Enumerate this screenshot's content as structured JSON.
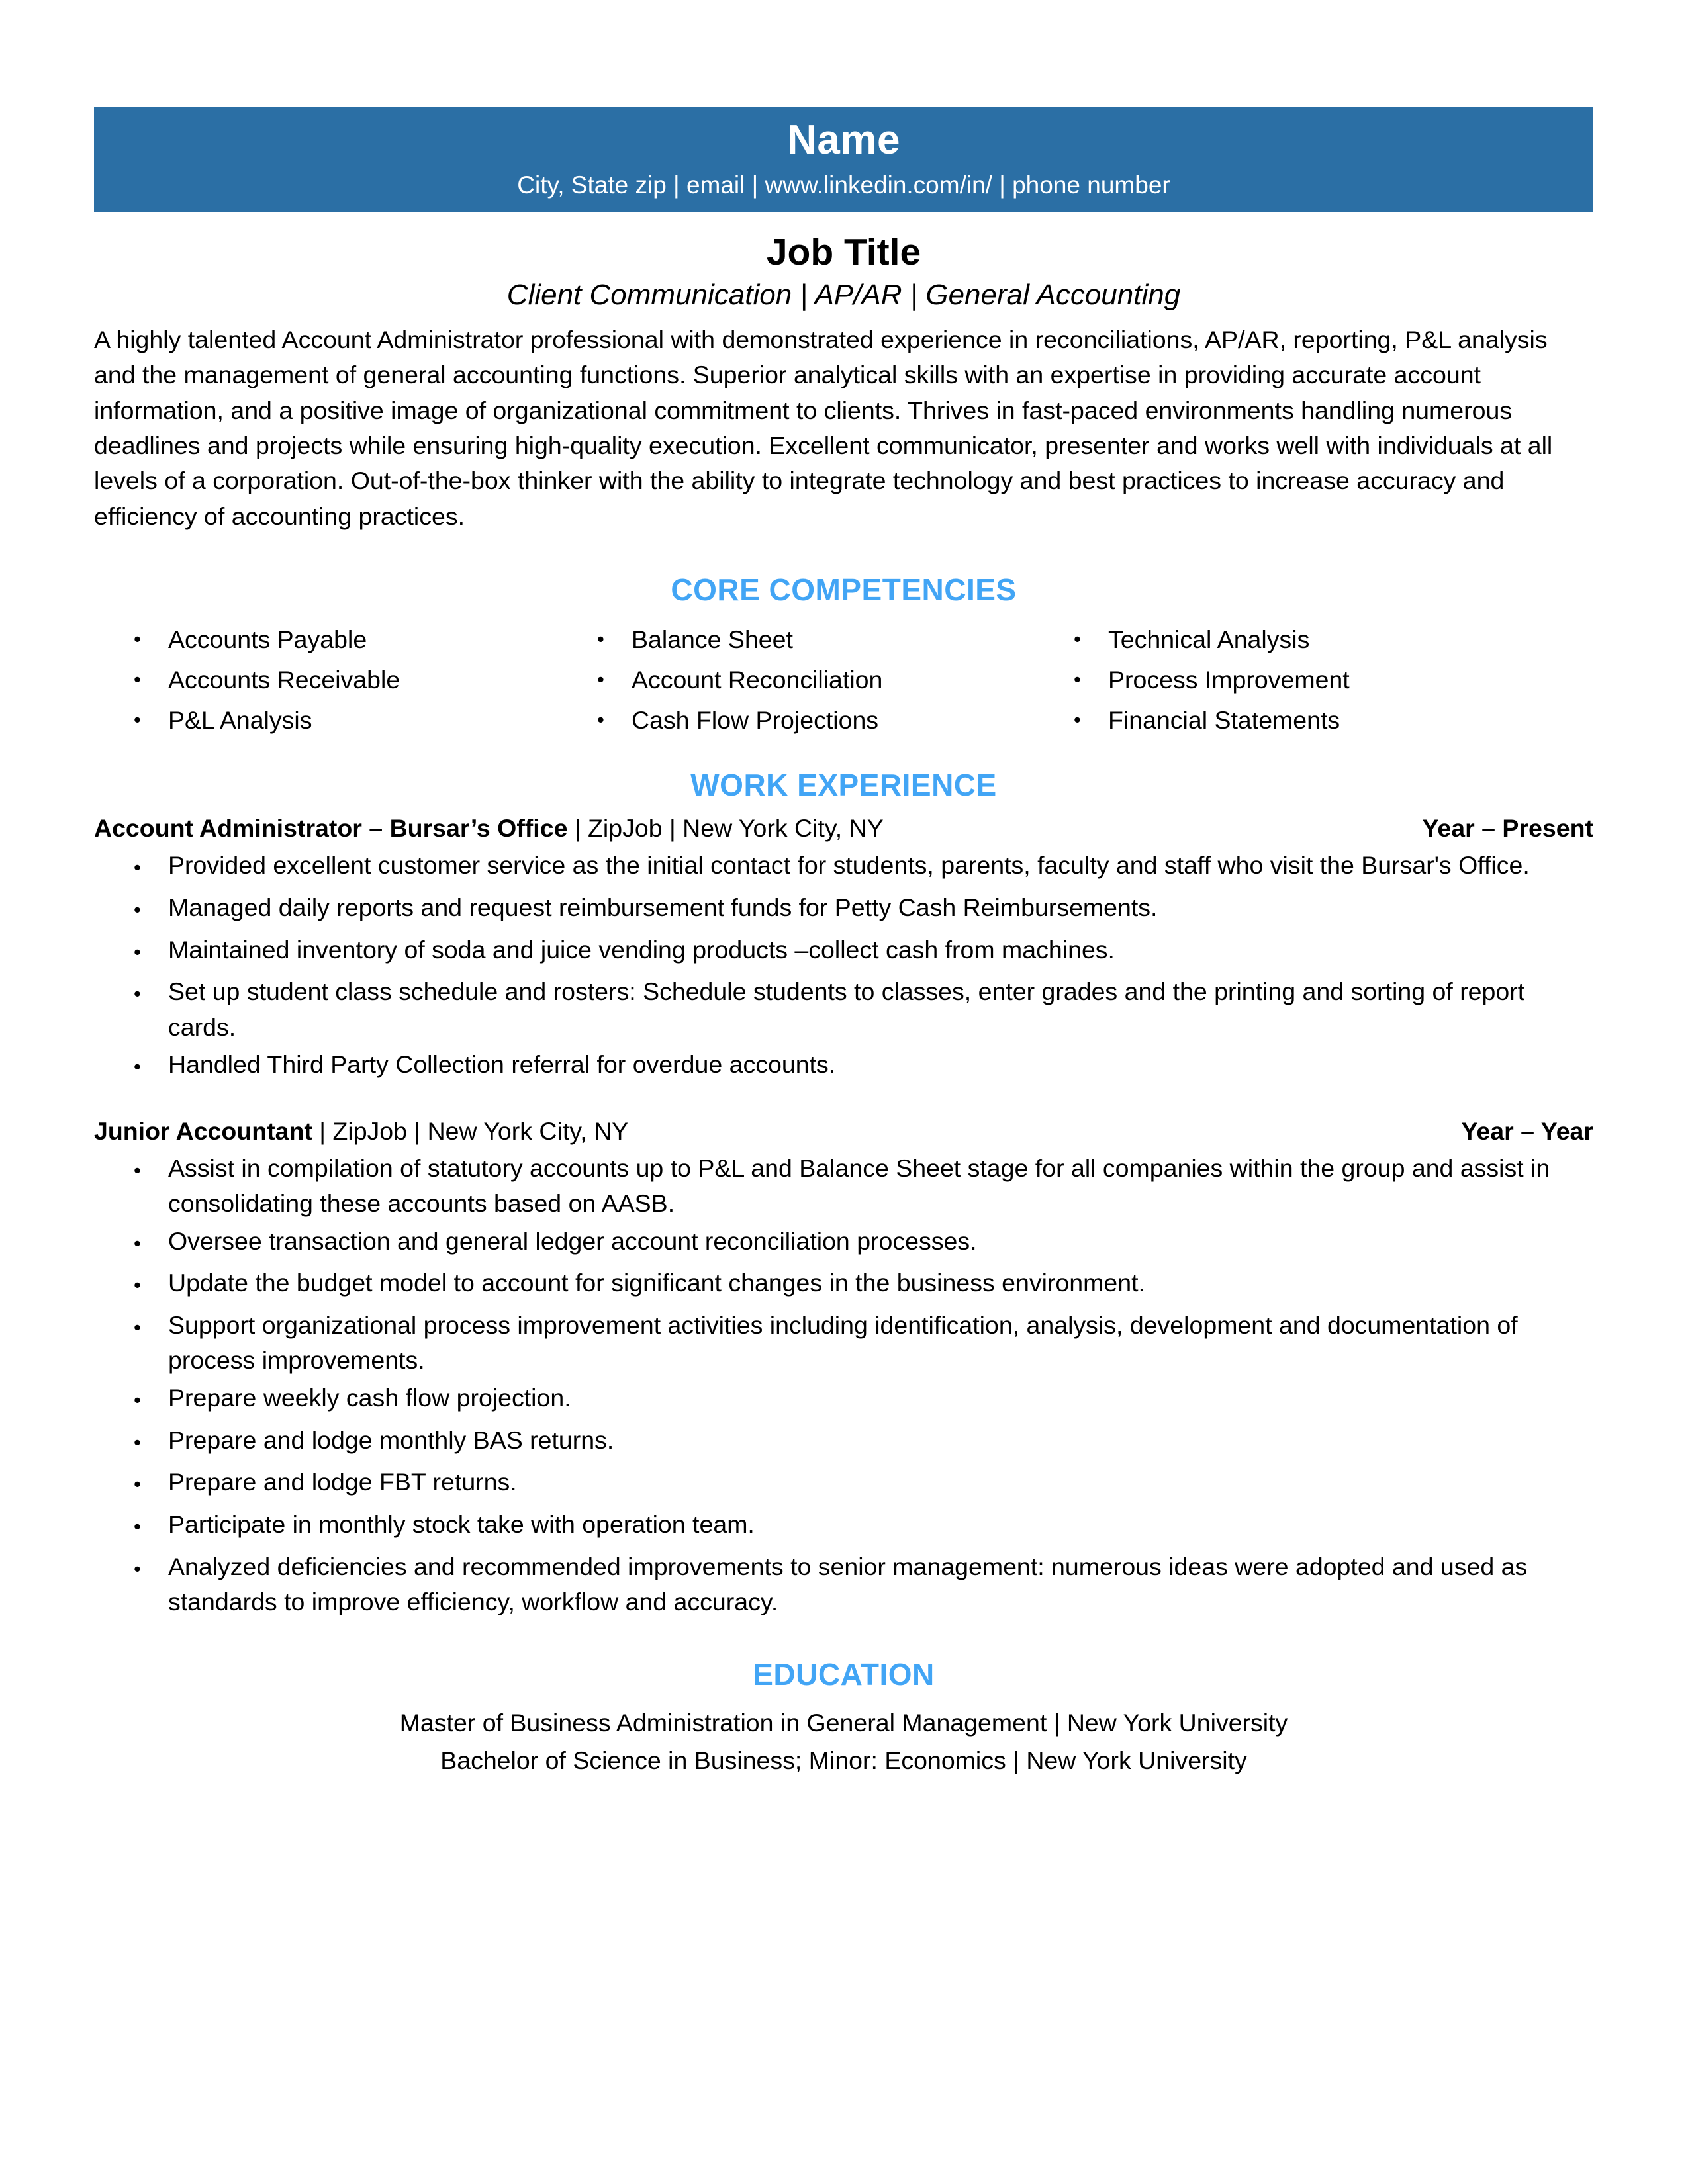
{
  "colors": {
    "banner_bg": "#2B6FA5",
    "section_heading": "#42A5F5",
    "text": "#000000",
    "banner_text": "#FFFFFF"
  },
  "header": {
    "name": "Name",
    "contact": "City, State zip | email | www.linkedin.com/in/ | phone number"
  },
  "title": {
    "job_title": "Job Title",
    "tagline": "Client Communication | AP/AR | General Accounting"
  },
  "summary": {
    "text": "A highly talented Account Administrator professional with demonstrated experience in reconciliations, AP/AR, reporting, P&L analysis and the management of general accounting functions.  Superior analytical skills with an expertise in providing accurate account information, and a positive image of organizational commitment to clients. Thrives in fast-paced environments handling numerous deadlines and projects while ensuring high-quality execution. Excellent communicator, presenter and works well with individuals at all levels of a corporation. Out-of-the-box thinker with the ability to integrate technology and best practices to increase accuracy and efficiency of accounting practices."
  },
  "core_competencies": {
    "heading": "CORE COMPETENCIES",
    "bullet_glyph": "•",
    "items": [
      "Accounts Payable",
      "Balance Sheet",
      "Technical Analysis",
      "Accounts Receivable",
      "Account Reconciliation",
      "Process Improvement",
      "P&L Analysis",
      "Cash Flow Projections",
      "Financial Statements"
    ]
  },
  "work_experience": {
    "heading": "WORK EXPERIENCE",
    "bullet_glyph": "•",
    "jobs": [
      {
        "role": "Account Administrator – Bursar’s Office",
        "meta": " | ZipJob | New York City, NY",
        "dates": "Year – Present",
        "bullets": [
          "Provided excellent customer service as the initial contact for students, parents, faculty and staff who visit the Bursar's Office.",
          "Managed daily reports and request reimbursement funds for Petty Cash Reimbursements.",
          "Maintained inventory of soda and juice vending products –collect cash from machines.",
          "Set up student class schedule and rosters: Schedule students to classes, enter grades and the printing and sorting of report cards.",
          "Handled Third Party Collection referral for overdue accounts."
        ]
      },
      {
        "role": "Junior Accountant",
        "meta": " | ZipJob | New York City, NY",
        "dates": "Year – Year",
        "bullets": [
          "Assist in compilation of statutory accounts up to P&L and Balance Sheet stage for all companies within the group and assist in consolidating these accounts based on AASB.",
          "Oversee transaction and general ledger account reconciliation processes.",
          "Update the budget model to account for significant changes in the business environment.",
          "Support organizational process improvement activities including identification, analysis, development and documentation of process improvements.",
          "Prepare weekly cash flow projection.",
          "Prepare and lodge monthly BAS returns.",
          "Prepare and lodge FBT returns.",
          "Participate in monthly stock take with operation team.",
          "Analyzed deficiencies and recommended improvements to senior management:  numerous ideas were adopted and used as standards to improve efficiency, workflow and accuracy."
        ]
      }
    ]
  },
  "education": {
    "heading": "EDUCATION",
    "entries": [
      "Master of Business Administration in General Management | New York University",
      "Bachelor of Science in Business; Minor: Economics | New York University"
    ]
  }
}
